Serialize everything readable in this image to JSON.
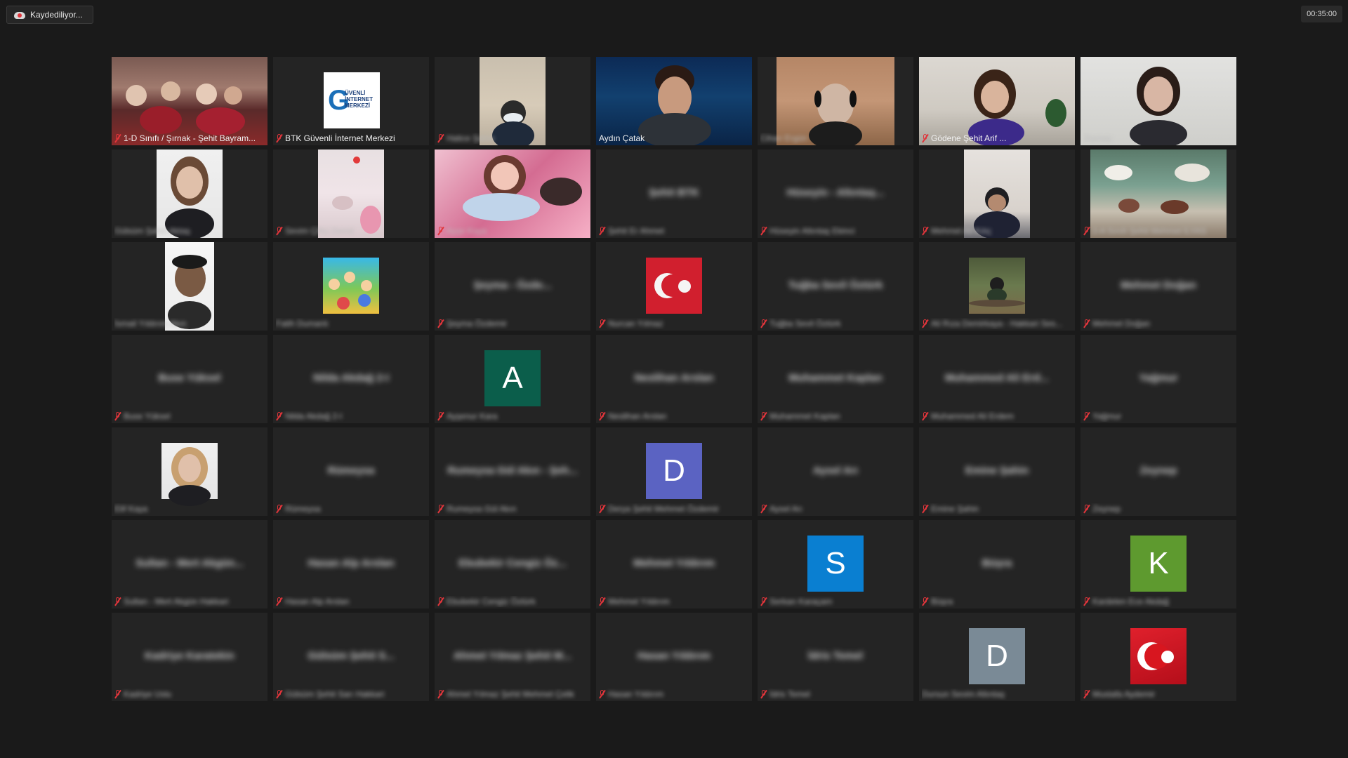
{
  "recording": {
    "label": "Kaydediliyor..."
  },
  "timer": {
    "value": "00:35:00"
  },
  "colors": {
    "active_border": "#d6e86b",
    "mic_off": "#e0353b"
  },
  "tiles": [
    {
      "label": "1-D Sınıfı / Şırnak - Şehit Bayram...",
      "label_blurred": false,
      "muted": true,
      "kind": "video",
      "video": "classroom-red"
    },
    {
      "label": "BTK Güvenli İnternet Merkezi",
      "label_blurred": false,
      "muted": true,
      "kind": "logo",
      "logo_letter": "G",
      "logo_text": "ÜVENLİ İNTERNET MERKEZİ"
    },
    {
      "label": "Hatice Şahin",
      "label_blurred": true,
      "muted": true,
      "kind": "video",
      "video": "child-mask"
    },
    {
      "label": "Aydın Çatak",
      "label_blurred": false,
      "muted": false,
      "active": true,
      "kind": "video",
      "video": "studio"
    },
    {
      "label": "Cihan Ergün",
      "label_blurred": true,
      "muted": false,
      "kind": "video",
      "video": "headset"
    },
    {
      "label": "Gödene Şehit Arif ...",
      "label_blurred": false,
      "muted": true,
      "kind": "video",
      "video": "woman-home"
    },
    {
      "label": "Zeynep",
      "label_blurred": true,
      "muted": false,
      "kind": "video",
      "video": "woman-glasses"
    },
    {
      "label": "Gülsüm Şahin Aktaş",
      "label_blurred": true,
      "muted": false,
      "kind": "video",
      "video": "woman-portrait"
    },
    {
      "label": "Sevim Çiftçi Demir",
      "label_blurred": true,
      "muted": true,
      "kind": "video",
      "video": "pink-room"
    },
    {
      "label": "Ayşe Kaya",
      "label_blurred": true,
      "muted": true,
      "kind": "video",
      "video": "girl-phone"
    },
    {
      "label": "Şehit Er Ahmet",
      "label_blurred": true,
      "muted": true,
      "kind": "name",
      "center": "Şehit BTK"
    },
    {
      "label": "Hüseyin Altıntaş Ekinci",
      "label_blurred": true,
      "muted": true,
      "kind": "name",
      "center": "Hüseyin - Altıntaş..."
    },
    {
      "label": "Mehmet Ali Kılıç",
      "label_blurred": true,
      "muted": true,
      "kind": "video",
      "video": "boy-room"
    },
    {
      "label": "2-A Sınıfı Şehit Mehmet İLYAS",
      "label_blurred": true,
      "muted": true,
      "kind": "video",
      "video": "classroom-green"
    },
    {
      "label": "İsmail Yıldırım Akın",
      "label_blurred": true,
      "muted": false,
      "kind": "video",
      "video": "man-glasses"
    },
    {
      "label": "Fatih Dumanlı",
      "label_blurred": true,
      "muted": false,
      "kind": "image",
      "video": "kids-cartoon"
    },
    {
      "label": "Şeyma Özdemir",
      "label_blurred": true,
      "muted": true,
      "kind": "name",
      "center": "Şeyma - Özde..."
    },
    {
      "label": "Nurcan Yılmaz",
      "label_blurred": true,
      "muted": true,
      "kind": "image",
      "video": "turkish-flag-fabric"
    },
    {
      "label": "Tuğba Sevil Öztürk",
      "label_blurred": true,
      "muted": true,
      "kind": "name",
      "center": "Tuğba Sevil Öztürk"
    },
    {
      "label": "Ali Rıza Demirkaya - Hakkari Ses...",
      "label_blurred": true,
      "muted": true,
      "kind": "image",
      "video": "forest-person"
    },
    {
      "label": "Mehmet Doğan",
      "label_blurred": true,
      "muted": true,
      "kind": "name",
      "center": "Mehmet Doğan"
    },
    {
      "label": "Buse Yüksel",
      "label_blurred": true,
      "muted": true,
      "kind": "name",
      "center": "Buse Yüksel"
    },
    {
      "label": "Nilda Akdağ 2-I",
      "label_blurred": true,
      "muted": true,
      "kind": "name",
      "center": "Nilda Akdağ 2-I"
    },
    {
      "label": "Ayşenur Kara",
      "label_blurred": true,
      "muted": true,
      "kind": "avatar",
      "letter": "A",
      "color": "#0b5e4b"
    },
    {
      "label": "Neslihan Arslan",
      "label_blurred": true,
      "muted": true,
      "kind": "name",
      "center": "Neslihan Arslan"
    },
    {
      "label": "Muhammet Kaplan",
      "label_blurred": true,
      "muted": true,
      "kind": "name",
      "center": "Muhammet Kaplan"
    },
    {
      "label": "Muhammed Ali Erdem",
      "label_blurred": true,
      "muted": true,
      "kind": "name",
      "center": "Muhammed Ali Erd..."
    },
    {
      "label": "Yağmur",
      "label_blurred": true,
      "muted": true,
      "kind": "name",
      "center": "Yağmur"
    },
    {
      "label": "Elif Kaya",
      "label_blurred": true,
      "muted": false,
      "kind": "video",
      "video": "woman-blonde"
    },
    {
      "label": "Rümeysa",
      "label_blurred": true,
      "muted": true,
      "kind": "name",
      "center": "Rümeysa"
    },
    {
      "label": "Rumeysa Gül Akın",
      "label_blurred": true,
      "muted": true,
      "kind": "name",
      "center": "Rumeysa Gül Akın - Şeh..."
    },
    {
      "label": "Derya Şehit Mehmet Özdemir",
      "label_blurred": true,
      "muted": true,
      "kind": "avatar",
      "letter": "D",
      "color": "#5b63c2"
    },
    {
      "label": "Aysel Arı",
      "label_blurred": true,
      "muted": true,
      "kind": "name",
      "center": "Aysel Arı"
    },
    {
      "label": "Emine Şahin",
      "label_blurred": true,
      "muted": true,
      "kind": "name",
      "center": "Emine Şahin"
    },
    {
      "label": "Zeynep",
      "label_blurred": true,
      "muted": true,
      "kind": "name",
      "center": "Zeynep"
    },
    {
      "label": "Sultan - Mert Akgün Hakkari",
      "label_blurred": true,
      "muted": true,
      "kind": "name",
      "center": "Sultan - Mert Akgün..."
    },
    {
      "label": "Hasan Alp Arslan",
      "label_blurred": true,
      "muted": true,
      "kind": "name",
      "center": "Hasan Alp Arslan"
    },
    {
      "label": "Ebubekir Cengiz Öztürk",
      "label_blurred": true,
      "muted": true,
      "kind": "name",
      "center": "Ebubekir Cengiz Öz..."
    },
    {
      "label": "Mehmet Yıldırım",
      "label_blurred": true,
      "muted": true,
      "kind": "name",
      "center": "Mehmet Yıldırım"
    },
    {
      "label": "Serkan Karaçam",
      "label_blurred": true,
      "muted": true,
      "kind": "avatar",
      "letter": "S",
      "color": "#0a7fd1"
    },
    {
      "label": "Büşra",
      "label_blurred": true,
      "muted": true,
      "kind": "name",
      "center": "Büşra"
    },
    {
      "label": "Kardelen Ece Akdağ",
      "label_blurred": true,
      "muted": true,
      "kind": "avatar",
      "letter": "K",
      "color": "#5e9a2f"
    },
    {
      "label": "Kadriye Uslu",
      "label_blurred": true,
      "muted": true,
      "kind": "name",
      "center": "Kadriye Karatekin"
    },
    {
      "label": "Gülsüm Şehit Sarı Hakkari",
      "label_blurred": true,
      "muted": true,
      "kind": "name",
      "center": "Gülsüm Şehit S..."
    },
    {
      "label": "Ahmet Yılmaz Şehit Mehmet Çelik",
      "label_blurred": true,
      "muted": true,
      "kind": "name",
      "center": "Ahmet Yılmaz Şehit M..."
    },
    {
      "label": "Hasan Yıldırım",
      "label_blurred": true,
      "muted": true,
      "kind": "name",
      "center": "Hasan Yıldırım"
    },
    {
      "label": "İdris Temel",
      "label_blurred": true,
      "muted": true,
      "kind": "name",
      "center": "İdris Temel"
    },
    {
      "label": "Dursun Sevim Altıntaş",
      "label_blurred": true,
      "muted": false,
      "kind": "avatar",
      "letter": "D",
      "color": "#7a8a96"
    },
    {
      "label": "Mustafa Aydemir",
      "label_blurred": true,
      "muted": true,
      "kind": "image",
      "video": "turkish-flag"
    }
  ]
}
